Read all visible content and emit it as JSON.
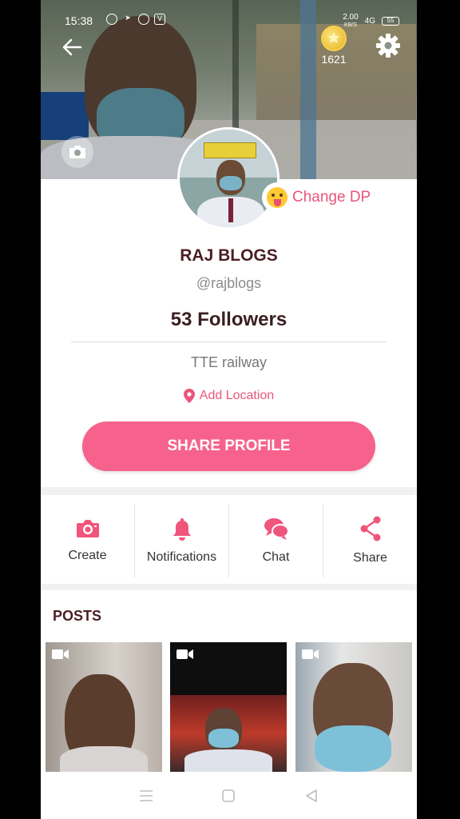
{
  "status_bar": {
    "time": "15:38",
    "network_speed": "2.00",
    "network_unit": "KB/S",
    "signal": "4G",
    "battery": "55"
  },
  "header": {
    "coin_count": "1621"
  },
  "profile": {
    "change_dp_label": "Change DP",
    "name": "RAJ BLOGS",
    "handle": "@rajblogs",
    "followers": "53 Followers",
    "bio": "TTE railway",
    "add_location": "Add Location",
    "share_profile_label": "SHARE PROFILE"
  },
  "actions": [
    {
      "label": "Create",
      "icon": "camera-icon"
    },
    {
      "label": "Notifications",
      "icon": "bell-icon"
    },
    {
      "label": "Chat",
      "icon": "chat-bubbles-icon"
    },
    {
      "label": "Share",
      "icon": "share-icon"
    }
  ],
  "posts": {
    "title": "POSTS",
    "items": [
      {
        "type": "video",
        "icon": "video-camera-icon"
      },
      {
        "type": "video",
        "icon": "video-camera-icon"
      },
      {
        "type": "video",
        "icon": "video-camera-icon"
      }
    ]
  },
  "colors": {
    "accent": "#f6628b",
    "accent_text": "#e8567c",
    "title_text": "#4a1f25"
  }
}
